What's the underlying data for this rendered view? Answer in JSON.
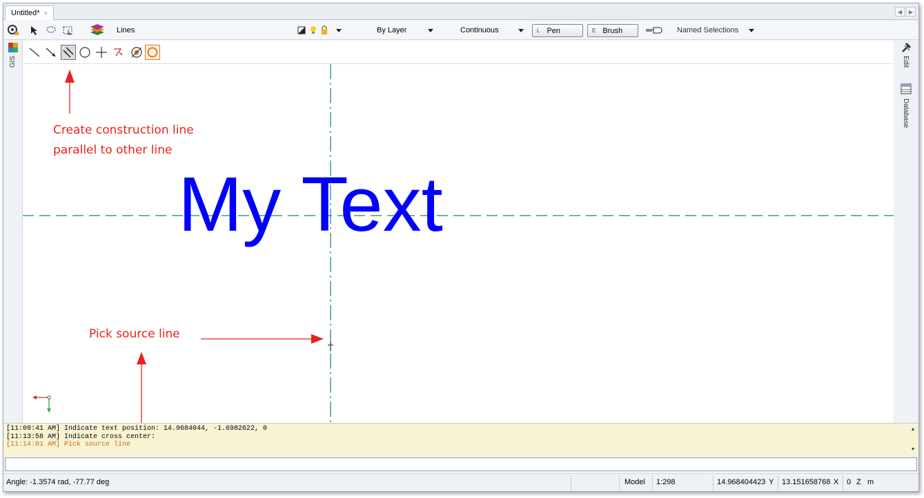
{
  "document": {
    "tab_title": "Untitled*",
    "tab_close": "×"
  },
  "toolbar": {
    "layer_name": "Lines",
    "color_value": "By Layer",
    "linetype_value": "Continuous",
    "pen_key": "L",
    "pen_label": "Pen",
    "brush_key": "E",
    "brush_label": "Brush",
    "named_selections": "Named Selections"
  },
  "side": {
    "left_tab": "GIS",
    "right_tab_edit": "Edit",
    "right_tab_database": "Database"
  },
  "canvas": {
    "big_text": "My Text",
    "annotation_top_line1": "Create construction line",
    "annotation_top_line2": "parallel to other line",
    "annotation_pick": "Pick source line"
  },
  "log": {
    "line1": "[11:09:41 AM] Indicate text position: 14.9684044, -1.6982622, 0",
    "line2": "[11:13:58 AM] Indicate cross center:",
    "line3": "[11:14:01 AM] Pick source line"
  },
  "status": {
    "angle": "Angle: -1.3574 rad, -77.77 deg",
    "mode": "Model",
    "scale": "1:298",
    "y_value": "14.968404423",
    "y_label": "Y",
    "x_value": "13.151658768",
    "x_label": "X",
    "z_value": "0",
    "z_label": "Z",
    "units": "m"
  },
  "colors": {
    "annotation": "#e8231c",
    "text": "#0000ff",
    "construction": "#1a7f7a",
    "log_bg": "#f8f3d3"
  }
}
